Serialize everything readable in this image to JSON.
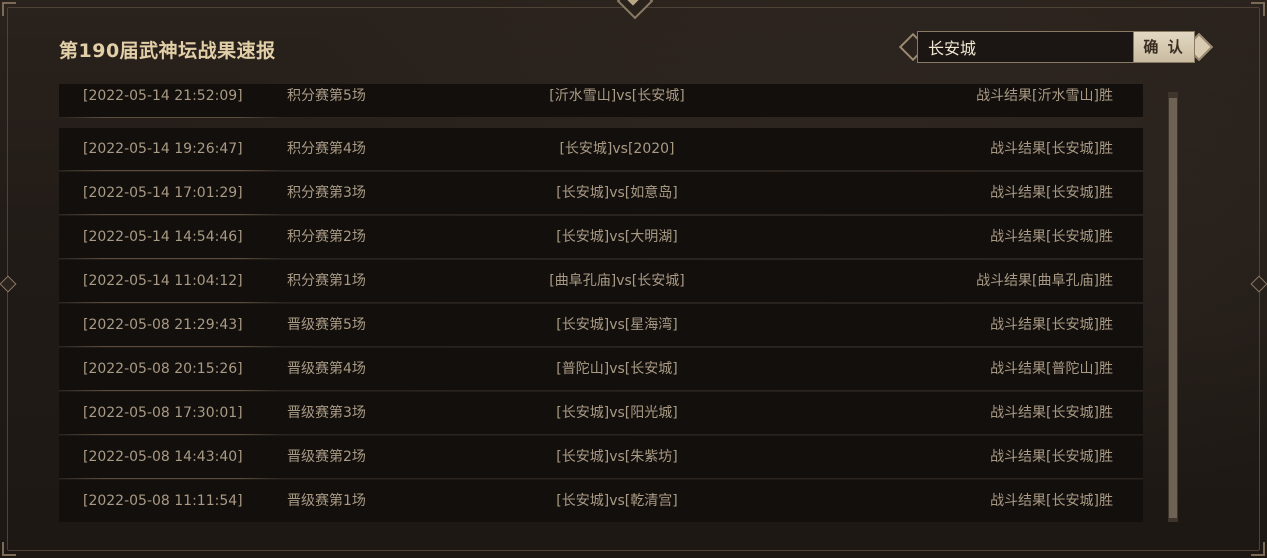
{
  "title": "第190届武神坛战果速报",
  "search": {
    "value": "长安城",
    "button_label": "确 认"
  },
  "rows": [
    {
      "time": "[2022-05-14 21:52:09]",
      "match": "积分赛第5场",
      "teams": "[沂水雪山]vs[长安城]",
      "result": "战斗结果[沂水雪山]胜"
    },
    {
      "time": "[2022-05-14 19:26:47]",
      "match": "积分赛第4场",
      "teams": "[长安城]vs[2020]",
      "result": "战斗结果[长安城]胜"
    },
    {
      "time": "[2022-05-14 17:01:29]",
      "match": "积分赛第3场",
      "teams": "[长安城]vs[如意岛]",
      "result": "战斗结果[长安城]胜"
    },
    {
      "time": "[2022-05-14 14:54:46]",
      "match": "积分赛第2场",
      "teams": "[长安城]vs[大明湖]",
      "result": "战斗结果[长安城]胜"
    },
    {
      "time": "[2022-05-14 11:04:12]",
      "match": "积分赛第1场",
      "teams": "[曲阜孔庙]vs[长安城]",
      "result": "战斗结果[曲阜孔庙]胜"
    },
    {
      "time": "[2022-05-08 21:29:43]",
      "match": "晋级赛第5场",
      "teams": "[长安城]vs[星海湾]",
      "result": "战斗结果[长安城]胜"
    },
    {
      "time": "[2022-05-08 20:15:26]",
      "match": "晋级赛第4场",
      "teams": "[普陀山]vs[长安城]",
      "result": "战斗结果[普陀山]胜"
    },
    {
      "time": "[2022-05-08 17:30:01]",
      "match": "晋级赛第3场",
      "teams": "[长安城]vs[阳光城]",
      "result": "战斗结果[长安城]胜"
    },
    {
      "time": "[2022-05-08 14:43:40]",
      "match": "晋级赛第2场",
      "teams": "[长安城]vs[朱紫坊]",
      "result": "战斗结果[长安城]胜"
    },
    {
      "time": "[2022-05-08 11:11:54]",
      "match": "晋级赛第1场",
      "teams": "[长安城]vs[乾清宫]",
      "result": "战斗结果[长安城]胜"
    }
  ],
  "colors": {
    "title": "#e2cfa8",
    "row_text": "#a89a84",
    "row_bg": "#130f0d",
    "panel_bg": "#241d18",
    "button_bg": "#d8cbb2"
  }
}
